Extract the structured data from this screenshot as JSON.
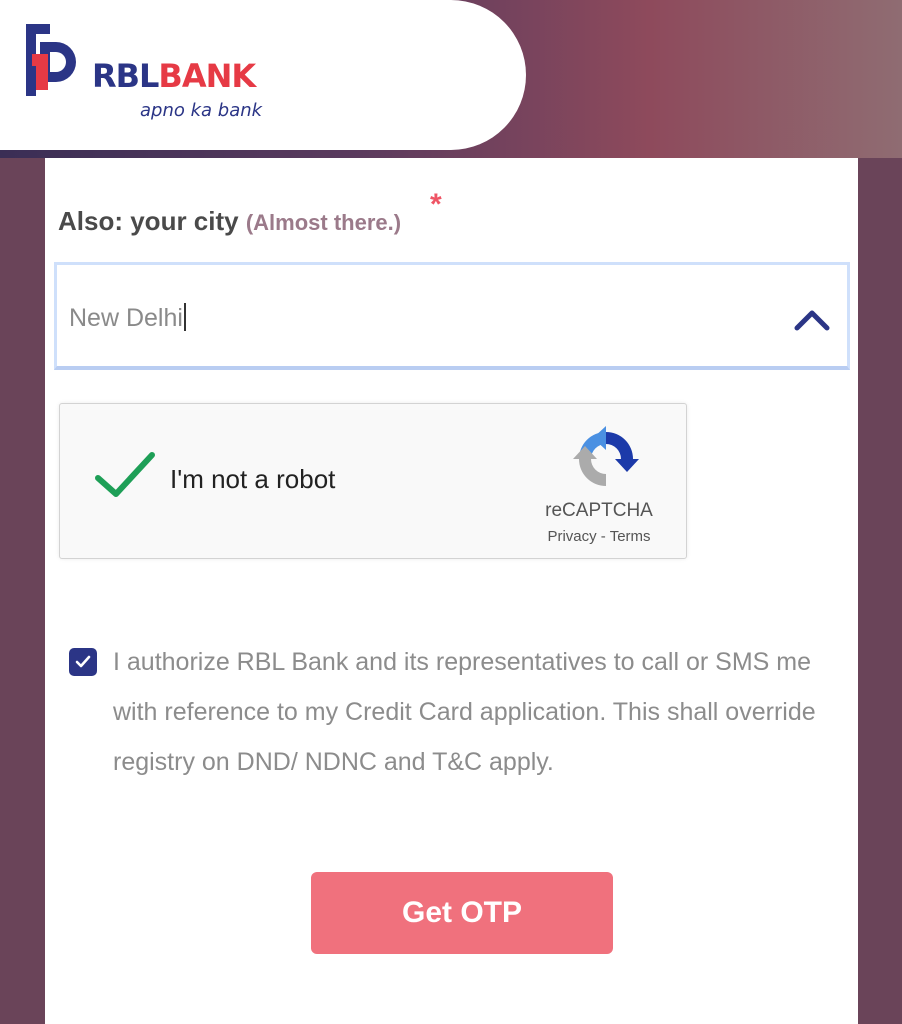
{
  "brand": {
    "name_part1": "RBL",
    "name_part2": "BANK",
    "tagline": "apno ka bank",
    "colors": {
      "primary": "#2b3586",
      "accent": "#e63a45"
    }
  },
  "icons": {
    "logo": "rbl-logo-icon",
    "select_toggle": "chevron-up-icon",
    "captcha_state": "green-checkmark-icon",
    "captcha_logo": "recaptcha-logo-icon",
    "consent_check": "checkmark-icon"
  },
  "form": {
    "city_label": "Also: your city",
    "city_hint": "(Almost there.)",
    "required_mark": "*",
    "city_value": "New Delhi"
  },
  "captcha": {
    "label": "I'm not a robot",
    "brand": "reCAPTCHA",
    "privacy_link": "Privacy",
    "separator": " - ",
    "terms_link": "Terms"
  },
  "consent": {
    "checked": true,
    "text": "I authorize RBL Bank and its representatives to call or SMS me with reference to my Credit Card application. This shall override registry on DND/ NDNC and T&C apply."
  },
  "actions": {
    "get_otp_label": "Get OTP",
    "button_color": "#f0717d"
  }
}
